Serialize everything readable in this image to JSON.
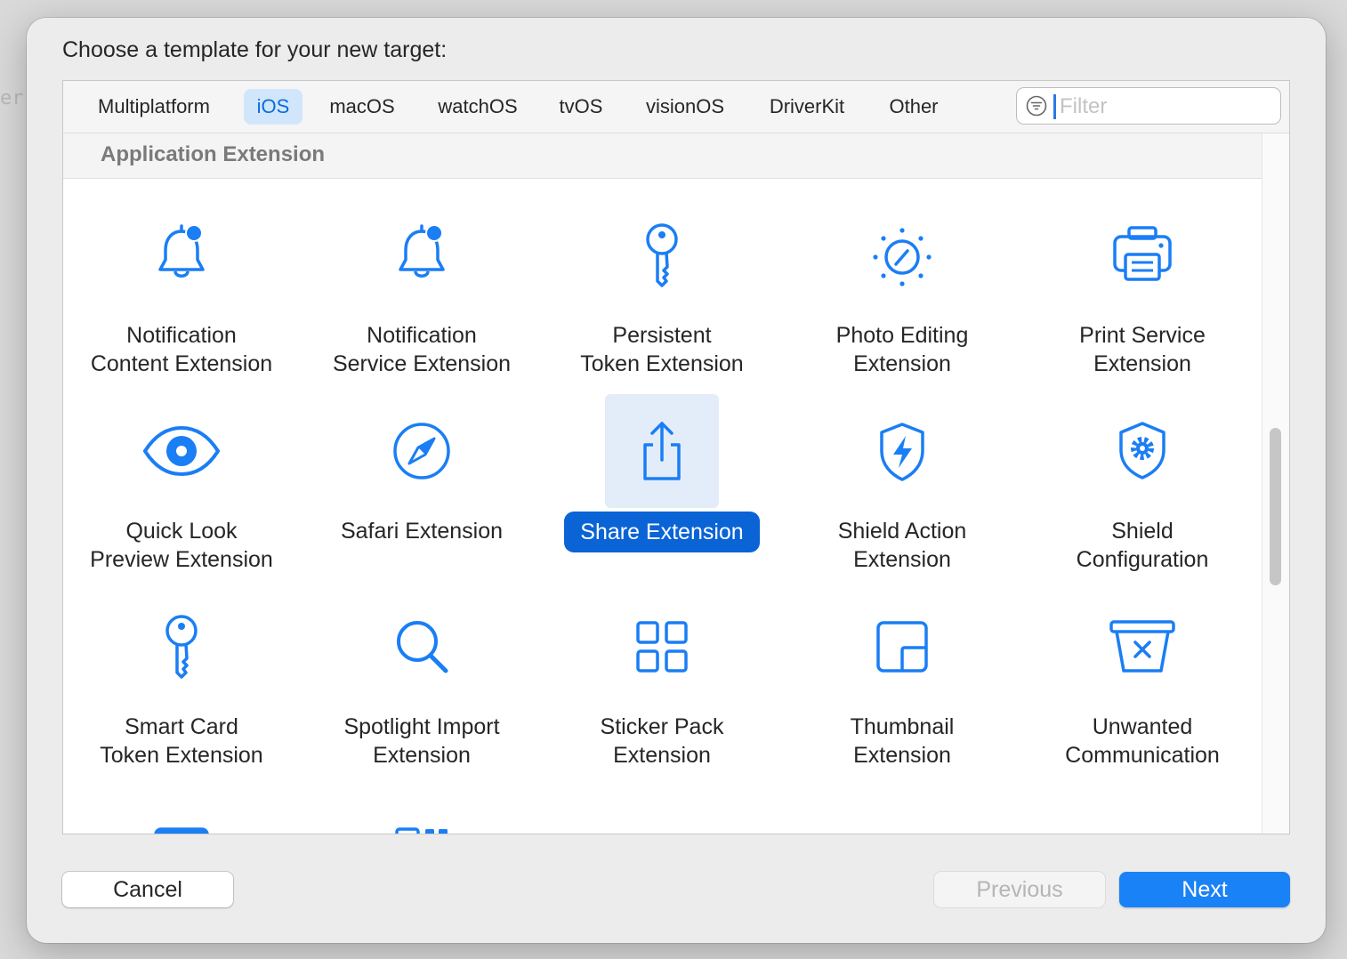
{
  "background": {
    "partial_text": "er"
  },
  "dialog": {
    "title": "Choose a template for your new target:"
  },
  "tabs": [
    {
      "label": "Multiplatform",
      "active": false
    },
    {
      "label": "iOS",
      "active": true
    },
    {
      "label": "macOS",
      "active": false
    },
    {
      "label": "watchOS",
      "active": false
    },
    {
      "label": "tvOS",
      "active": false
    },
    {
      "label": "visionOS",
      "active": false
    },
    {
      "label": "DriverKit",
      "active": false
    },
    {
      "label": "Other",
      "active": false
    }
  ],
  "filter": {
    "placeholder": "Filter",
    "value": "",
    "icon": "filter-icon"
  },
  "section": {
    "title": "Application Extension"
  },
  "templates": [
    {
      "label": "Notification\nContent Extension",
      "icon": "bell-badge-icon"
    },
    {
      "label": "Notification\nService Extension",
      "icon": "bell-badge-icon"
    },
    {
      "label": "Persistent\nToken Extension",
      "icon": "key-icon"
    },
    {
      "label": "Photo Editing\nExtension",
      "icon": "photo-editing-dial-icon"
    },
    {
      "label": "Print Service\nExtension",
      "icon": "printer-icon"
    },
    {
      "label": "Quick Look\nPreview Extension",
      "icon": "eye-icon"
    },
    {
      "label": "Safari Extension",
      "icon": "compass-icon"
    },
    {
      "label": "Share Extension",
      "icon": "share-icon",
      "selected": true
    },
    {
      "label": "Shield Action\nExtension",
      "icon": "shield-bolt-icon"
    },
    {
      "label": "Shield\nConfiguration",
      "icon": "shield-gear-icon"
    },
    {
      "label": "Smart Card\nToken Extension",
      "icon": "key-icon"
    },
    {
      "label": "Spotlight Import\nExtension",
      "icon": "magnifying-glass-icon"
    },
    {
      "label": "Sticker Pack\nExtension",
      "icon": "grid-squares-icon"
    },
    {
      "label": "Thumbnail\nExtension",
      "icon": "thumbnail-icon"
    },
    {
      "label": "Unwanted\nCommunication",
      "icon": "trash-x-icon"
    },
    {
      "label": "",
      "icon": "calendar-window-icon"
    },
    {
      "label": "",
      "icon": "widget-grid-icon"
    }
  ],
  "buttons": {
    "cancel": "Cancel",
    "previous": "Previous",
    "next": "Next"
  },
  "colors": {
    "accent": "#0a6cde",
    "icon_blue": "#1a7ef5",
    "selected_bg": "#e3edf9",
    "primary_button": "#1a82f7"
  }
}
